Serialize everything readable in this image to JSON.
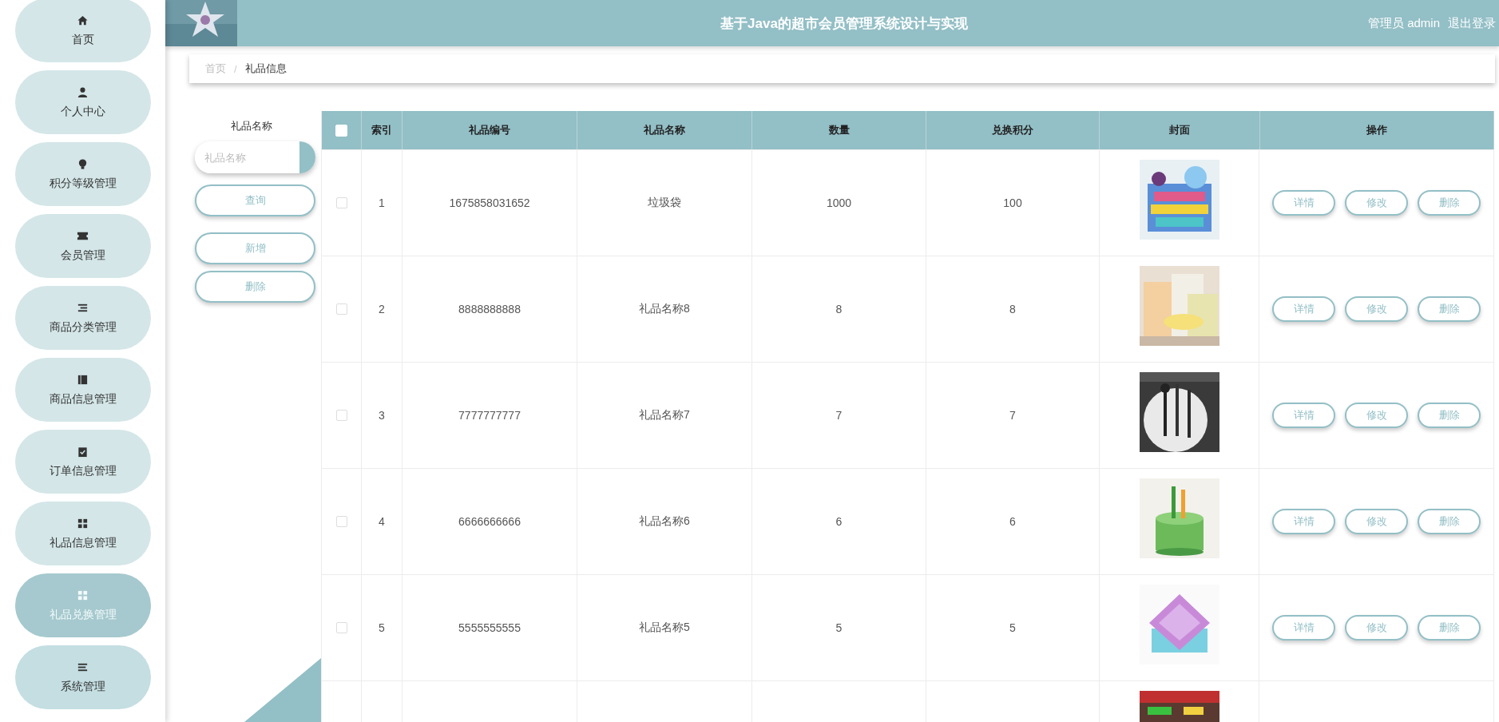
{
  "sidebar": {
    "items": [
      {
        "label": "首页",
        "kind": "home",
        "hovered": false
      },
      {
        "label": "个人中心",
        "kind": "person",
        "hovered": false
      },
      {
        "label": "积分等级管理",
        "kind": "bulb",
        "hovered": false
      },
      {
        "label": "会员管理",
        "kind": "ticket",
        "hovered": false
      },
      {
        "label": "商品分类管理",
        "kind": "list",
        "hovered": false
      },
      {
        "label": "商品信息管理",
        "kind": "book",
        "hovered": false
      },
      {
        "label": "订单信息管理",
        "kind": "clipboard",
        "hovered": false
      },
      {
        "label": "礼品信息管理",
        "kind": "grid",
        "hovered": false
      },
      {
        "label": "礼品兑换管理",
        "kind": "grid",
        "hovered": true
      },
      {
        "label": "系统管理",
        "kind": "menu",
        "hovered": false
      }
    ]
  },
  "header": {
    "title": "基于Java的超市会员管理系统设计与实现",
    "user": "管理员 admin",
    "logout": "退出登录"
  },
  "breadcrumb": {
    "items": [
      {
        "label": "首页",
        "current": false
      },
      {
        "label": "礼品信息",
        "current": true
      }
    ],
    "separator": "/"
  },
  "search": {
    "label": "礼品名称",
    "placeholder": "礼品名称",
    "query_button": "查询"
  },
  "actions": [
    "新增",
    "删除"
  ],
  "table": {
    "select_all_checked": false,
    "columns": [
      "索引",
      "礼品编号",
      "礼品名称",
      "数量",
      "兑换积分",
      "封面",
      "操作"
    ],
    "rows": [
      {
        "checked": false,
        "cells": [
          "1",
          "1675858031652",
          "垃圾袋",
          "1000",
          "100"
        ],
        "cover": {
          "kind": "picture"
        },
        "actions": [
          "详情",
          "修改",
          "删除"
        ]
      },
      {
        "checked": false,
        "cells": [
          "2",
          "8888888888",
          "礼品名称8",
          "8",
          "8"
        ],
        "cover": {
          "kind": "picture"
        },
        "actions": [
          "详情",
          "修改",
          "删除"
        ]
      },
      {
        "checked": false,
        "cells": [
          "3",
          "7777777777",
          "礼品名称7",
          "7",
          "7"
        ],
        "cover": {
          "kind": "picture"
        },
        "actions": [
          "详情",
          "修改",
          "删除"
        ]
      },
      {
        "checked": false,
        "cells": [
          "4",
          "6666666666",
          "礼品名称6",
          "6",
          "6"
        ],
        "cover": {
          "kind": "picture"
        },
        "actions": [
          "详情",
          "修改",
          "删除"
        ]
      },
      {
        "checked": false,
        "cells": [
          "5",
          "5555555555",
          "礼品名称5",
          "5",
          "5"
        ],
        "cover": {
          "kind": "picture"
        },
        "actions": [
          "详情",
          "修改",
          "删除"
        ]
      },
      {
        "cover": {
          "kind": "picture"
        }
      }
    ]
  }
}
